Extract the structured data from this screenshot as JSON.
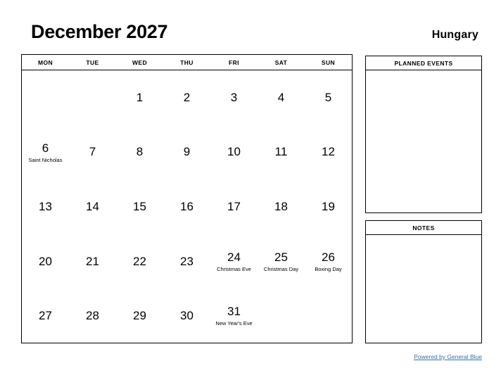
{
  "header": {
    "title": "December 2027",
    "country": "Hungary"
  },
  "calendar": {
    "weekdays": [
      "MON",
      "TUE",
      "WED",
      "THU",
      "FRI",
      "SAT",
      "SUN"
    ],
    "weeks": [
      [
        {
          "day": "",
          "event": ""
        },
        {
          "day": "",
          "event": ""
        },
        {
          "day": "1",
          "event": ""
        },
        {
          "day": "2",
          "event": ""
        },
        {
          "day": "3",
          "event": ""
        },
        {
          "day": "4",
          "event": ""
        },
        {
          "day": "5",
          "event": ""
        }
      ],
      [
        {
          "day": "6",
          "event": "Saint Nicholas"
        },
        {
          "day": "7",
          "event": ""
        },
        {
          "day": "8",
          "event": ""
        },
        {
          "day": "9",
          "event": ""
        },
        {
          "day": "10",
          "event": ""
        },
        {
          "day": "11",
          "event": ""
        },
        {
          "day": "12",
          "event": ""
        }
      ],
      [
        {
          "day": "13",
          "event": ""
        },
        {
          "day": "14",
          "event": ""
        },
        {
          "day": "15",
          "event": ""
        },
        {
          "day": "16",
          "event": ""
        },
        {
          "day": "17",
          "event": ""
        },
        {
          "day": "18",
          "event": ""
        },
        {
          "day": "19",
          "event": ""
        }
      ],
      [
        {
          "day": "20",
          "event": ""
        },
        {
          "day": "21",
          "event": ""
        },
        {
          "day": "22",
          "event": ""
        },
        {
          "day": "23",
          "event": ""
        },
        {
          "day": "24",
          "event": "Christmas Eve"
        },
        {
          "day": "25",
          "event": "Christmas Day"
        },
        {
          "day": "26",
          "event": "Boxing Day"
        }
      ],
      [
        {
          "day": "27",
          "event": ""
        },
        {
          "day": "28",
          "event": ""
        },
        {
          "day": "29",
          "event": ""
        },
        {
          "day": "30",
          "event": ""
        },
        {
          "day": "31",
          "event": "New Year's Eve"
        },
        {
          "day": "",
          "event": ""
        },
        {
          "day": "",
          "event": ""
        }
      ]
    ]
  },
  "panels": {
    "planned_events": {
      "title": "PLANNED EVENTS",
      "content": ""
    },
    "notes": {
      "title": "NOTES",
      "content": ""
    }
  },
  "footer": {
    "link_label": "Powered by General Blue",
    "link_color": "#3a6ea5"
  }
}
